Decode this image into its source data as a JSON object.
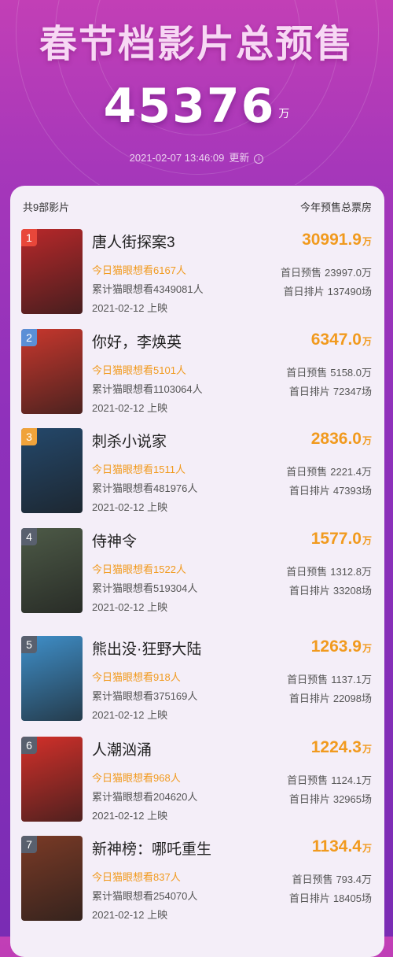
{
  "header": {
    "title": "春节档影片总预售",
    "total": "45376",
    "total_unit": "万",
    "update_time": "2021-02-07 13:46:09",
    "update_label": "更新",
    "info_icon": "info-icon"
  },
  "panel": {
    "count_label": "共9部影片",
    "col_label": "今年预售总票房"
  },
  "labels": {
    "presale": "首日预售",
    "schedule": "首日排片",
    "unit": "万"
  },
  "movies": [
    {
      "rank": "1",
      "title": "唐人街探案3",
      "box": "30991.9",
      "today": "今日猫眼想看6167人",
      "cum": "累计猫眼想看4349081人",
      "date": "2021-02-12 上映",
      "presale": "23997.0万",
      "schedule": "137490场",
      "rank_color": "#e8473a",
      "poster_color": "#b8282a"
    },
    {
      "rank": "2",
      "title": "你好，李焕英",
      "box": "6347.0",
      "today": "今日猫眼想看5101人",
      "cum": "累计猫眼想看1103064人",
      "date": "2021-02-12 上映",
      "presale": "5158.0万",
      "schedule": "72347场",
      "rank_color": "#5b8fd6",
      "poster_color": "#c8372d"
    },
    {
      "rank": "3",
      "title": "刺杀小说家",
      "box": "2836.0",
      "today": "今日猫眼想看1511人",
      "cum": "累计猫眼想看481976人",
      "date": "2021-02-12 上映",
      "presale": "2221.4万",
      "schedule": "47393场",
      "rank_color": "#f0a33b",
      "poster_color": "#24486b"
    },
    {
      "rank": "4",
      "title": "侍神令",
      "box": "1577.0",
      "today": "今日猫眼想看1522人",
      "cum": "累计猫眼想看519304人",
      "date": "2021-02-12 上映",
      "presale": "1312.8万",
      "schedule": "33208场",
      "rank_color": "#59606e",
      "poster_color": "#4d5a47"
    },
    {
      "rank": "5",
      "title": "熊出没·狂野大陆",
      "box": "1263.9",
      "today": "今日猫眼想看918人",
      "cum": "累计猫眼想看375169人",
      "date": "2021-02-12 上映",
      "presale": "1137.1万",
      "schedule": "22098场",
      "rank_color": "#59606e",
      "poster_color": "#3f8fc9"
    },
    {
      "rank": "6",
      "title": "人潮汹涌",
      "box": "1224.3",
      "today": "今日猫眼想看968人",
      "cum": "累计猫眼想看204620人",
      "date": "2021-02-12 上映",
      "presale": "1124.1万",
      "schedule": "32965场",
      "rank_color": "#59606e",
      "poster_color": "#d3302a"
    },
    {
      "rank": "7",
      "title": "新神榜：哪吒重生",
      "box": "1134.4",
      "today": "今日猫眼想看837人",
      "cum": "累计猫眼想看254070人",
      "date": "2021-02-12 上映",
      "presale": "793.4万",
      "schedule": "18405场",
      "rank_color": "#59606e",
      "poster_color": "#7a3a26"
    }
  ]
}
